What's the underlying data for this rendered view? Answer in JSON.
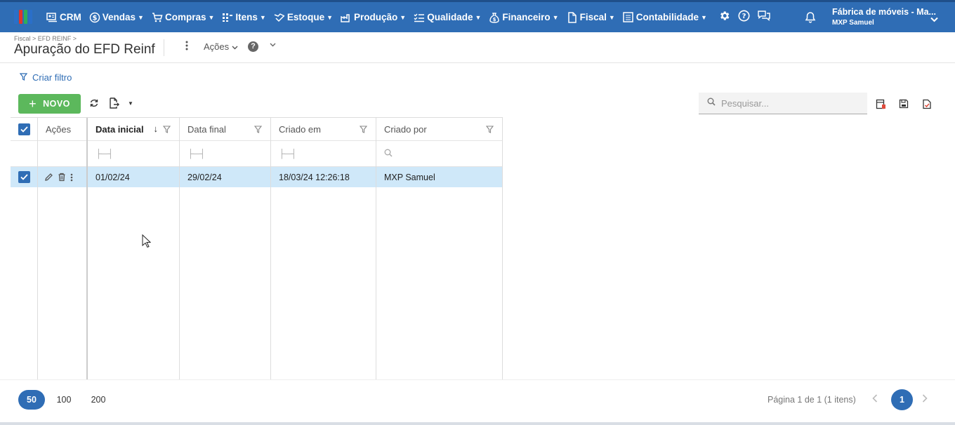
{
  "colors": {
    "nav_bg": "#2f6db5",
    "accent": "#2f6db5",
    "new_button": "#5cb85c",
    "selected_row": "#cfe8f9",
    "logo": [
      "#2a6fc9",
      "#e0352b",
      "#2eae5a",
      "#2a6fc9"
    ]
  },
  "nav": {
    "items": [
      {
        "label": "CRM",
        "icon": "crm-icon"
      },
      {
        "label": "Vendas",
        "icon": "dollar-circle-icon"
      },
      {
        "label": "Compras",
        "icon": "cart-icon"
      },
      {
        "label": "Itens",
        "icon": "items-grid-icon"
      },
      {
        "label": "Estoque",
        "icon": "stock-icon"
      },
      {
        "label": "Produção",
        "icon": "factory-icon"
      },
      {
        "label": "Qualidade",
        "icon": "checklist-icon"
      },
      {
        "label": "Financeiro",
        "icon": "money-bag-icon"
      },
      {
        "label": "Fiscal",
        "icon": "document-icon"
      },
      {
        "label": "Contabilidade",
        "icon": "ledger-icon"
      }
    ],
    "company": "Fábrica de móveis - Ma...",
    "user": "MXP Samuel"
  },
  "header": {
    "breadcrumb": "Fiscal > EFD REINF >",
    "title": "Apuração do EFD Reinf",
    "actions_label": "Ações"
  },
  "toolbar": {
    "filter_label": "Criar filtro",
    "new_label": "NOVO",
    "search_placeholder": "Pesquisar..."
  },
  "grid": {
    "columns": [
      "Ações",
      "Data inicial",
      "Data final",
      "Criado em",
      "Criado por"
    ],
    "sorted_column": "Data inicial",
    "sort_direction": "descending",
    "rows": [
      {
        "data_inicial": "01/02/24",
        "data_final": "29/02/24",
        "criado_em": "18/03/24 12:26:18",
        "criado_por": "MXP Samuel",
        "selected": true
      }
    ]
  },
  "pager": {
    "sizes": [
      "50",
      "100",
      "200"
    ],
    "active_size": "50",
    "info": "Página 1 de 1 (1 itens)",
    "current_page": "1"
  }
}
